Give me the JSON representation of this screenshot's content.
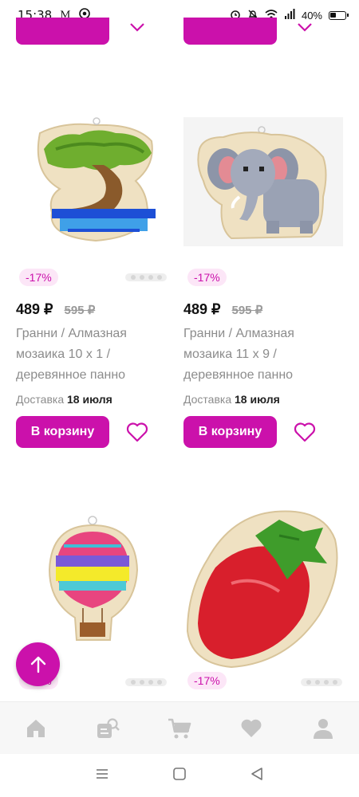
{
  "status_bar": {
    "time": "15:38",
    "battery": "40%",
    "notification_icons": [
      "gmail-icon",
      "chrome-icon"
    ],
    "system_icons": [
      "alarm-icon",
      "mute-icon",
      "wifi-icon",
      "signal-icon",
      "battery-icon"
    ]
  },
  "products": [
    {
      "discount": "-17%",
      "price": "489 ₽",
      "old_price": "595 ₽",
      "title": "Гранни / Алмазная мозаика 10 х 1 / деревянное панно",
      "delivery_label": "Доставка",
      "delivery_date": "18 июля",
      "cart_label": "В корзину",
      "image": "bonsai-tree-mosaic"
    },
    {
      "discount": "-17%",
      "price": "489 ₽",
      "old_price": "595 ₽",
      "title": "Гранни / Алмазная мозаика 11 х 9 / деревянное панно",
      "delivery_label": "Доставка",
      "delivery_date": "18 июля",
      "cart_label": "В корзину",
      "image": "elephant-mosaic"
    },
    {
      "discount": "-17%",
      "image": "hot-air-balloon-mosaic"
    },
    {
      "discount": "-17%",
      "image": "strawberry-mosaic"
    }
  ],
  "bottom_nav": [
    "home-icon",
    "catalog-search-icon",
    "cart-icon",
    "favorites-icon",
    "profile-icon"
  ],
  "colors": {
    "brand": "#cb11ab",
    "discount_bg": "#fce6f7",
    "nav_icon": "#c4c4c4"
  }
}
